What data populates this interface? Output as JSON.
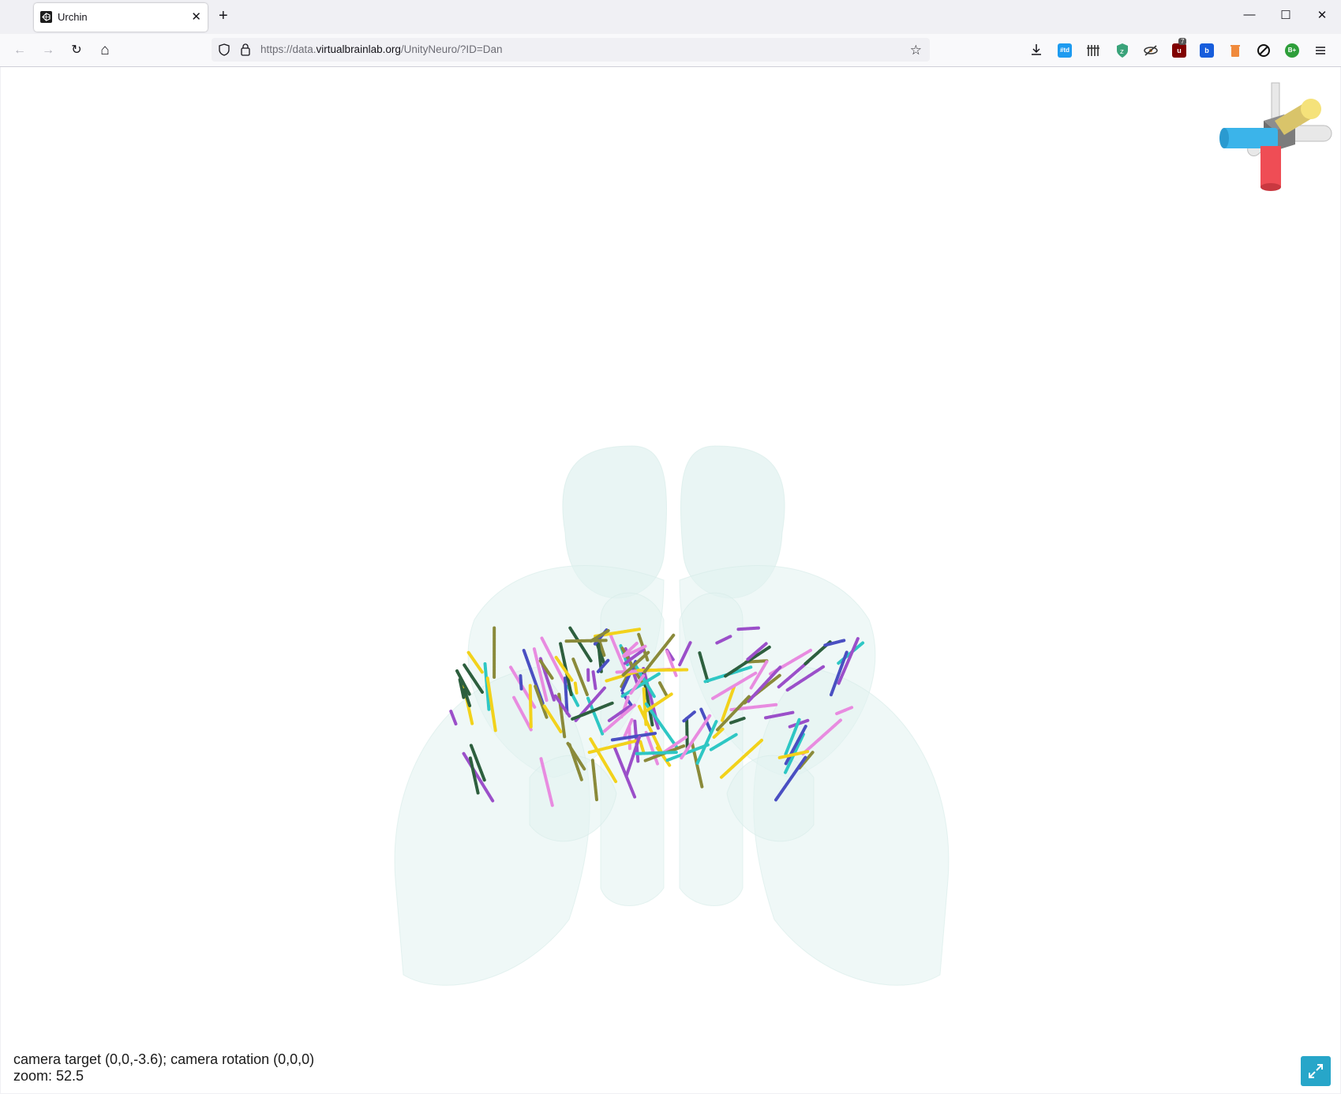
{
  "browser": {
    "tab_title": "Urchin",
    "url_scheme": "https://data.",
    "url_domain": "virtualbrainlab.org",
    "url_path": "/UnityNeuro/?ID=Dan",
    "new_tab_glyph": "+",
    "close_tab_glyph": "✕",
    "window_controls": {
      "minimize": "—",
      "maximize": "☐",
      "close": "✕"
    },
    "nav": {
      "back": "←",
      "forward": "→",
      "reload": "↻",
      "home": "⌂"
    },
    "extension_badge": "7",
    "extensions": [
      "download-icon",
      "td-extension-icon",
      "columns-icon",
      "shield-extension-icon",
      "eye-extension-icon",
      "ublock-icon",
      "bitwarden-icon",
      "trash-icon",
      "block-icon",
      "b-plus-icon",
      "menu-icon"
    ]
  },
  "viewer": {
    "camera_info": "camera target (0,0,-3.6); camera rotation (0,0,0)",
    "zoom_info": "zoom: 52.5",
    "axis_colors": {
      "ap": "#3bb4ea",
      "dv": "#ef4d55",
      "ml": "#f5e27a",
      "neutral": "#e8e8e8"
    },
    "brain_color": "#e2f2f0",
    "probe_colors": [
      "#f2d21b",
      "#9b4fc9",
      "#e88be0",
      "#2d5f3e",
      "#4a4fc2",
      "#2ec7c4",
      "#8a8a3a"
    ]
  }
}
